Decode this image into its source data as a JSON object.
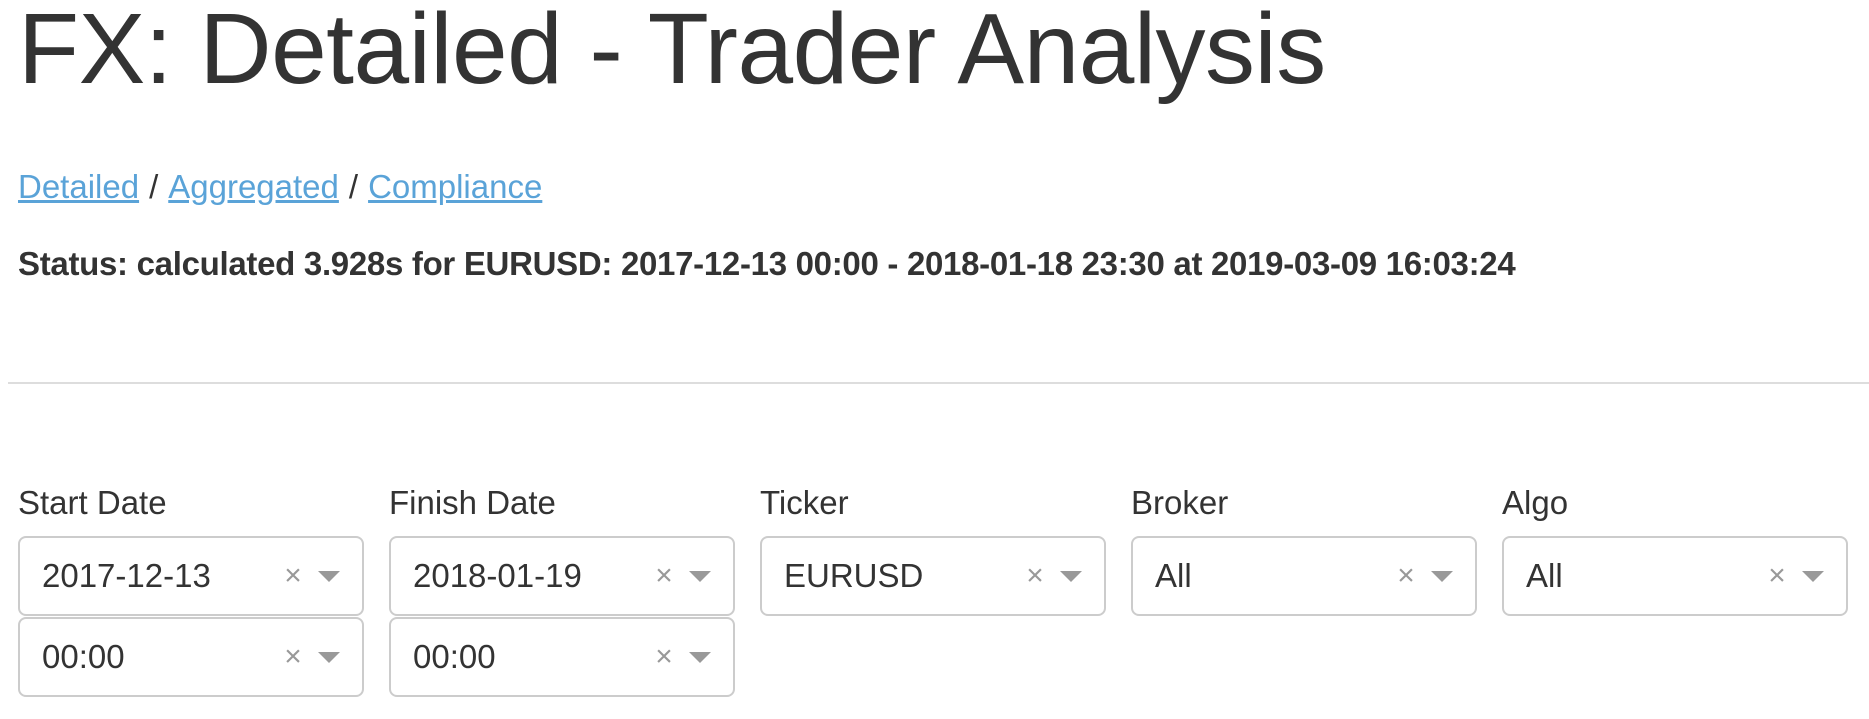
{
  "page": {
    "title": "FX: Detailed - Trader Analysis"
  },
  "nav": {
    "links": [
      "Detailed",
      "Aggregated",
      "Compliance"
    ],
    "separator": "/"
  },
  "status": {
    "text": "Status: calculated 3.928s for EURUSD: 2017-12-13 00:00 - 2018-01-18 23:30 at 2019-03-09 16:03:24"
  },
  "filters": {
    "start_date": {
      "label": "Start Date",
      "date_value": "2017-12-13",
      "time_value": "00:00"
    },
    "finish_date": {
      "label": "Finish Date",
      "date_value": "2018-01-19",
      "time_value": "00:00"
    },
    "ticker": {
      "label": "Ticker",
      "value": "EURUSD"
    },
    "broker": {
      "label": "Broker",
      "value": "All"
    },
    "algo": {
      "label": "Algo",
      "value": "All"
    },
    "clear_glyph": "×",
    "icons": {
      "clear": "close-icon",
      "dropdown": "chevron-down-icon"
    }
  }
}
